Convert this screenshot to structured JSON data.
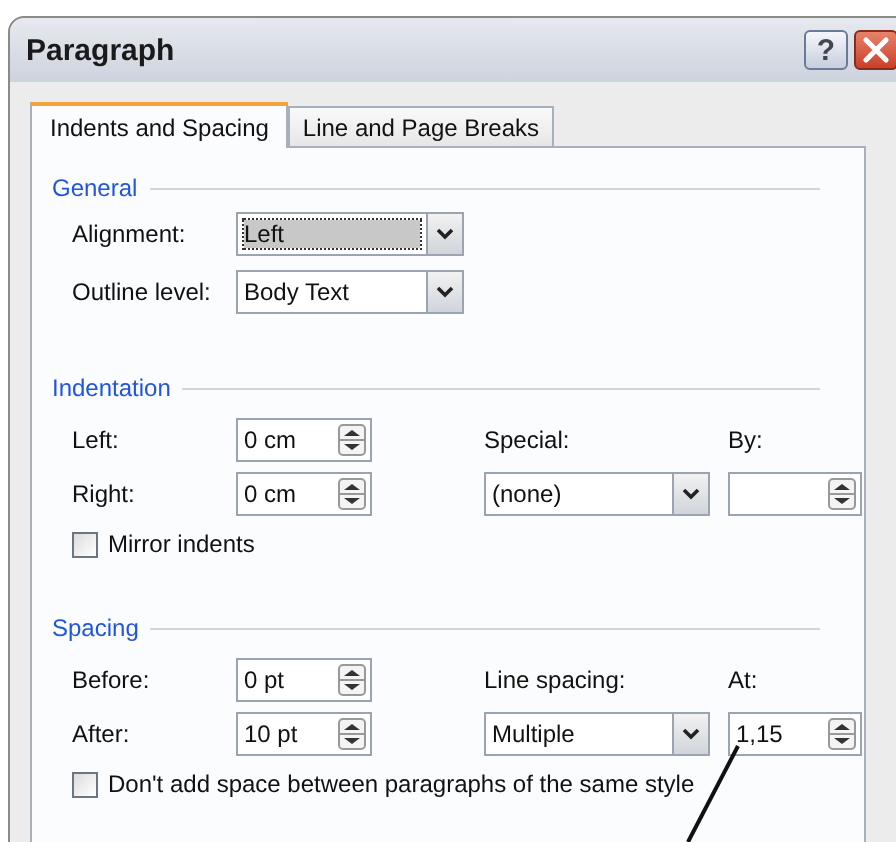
{
  "window": {
    "title": "Paragraph",
    "help_button": "?"
  },
  "tabs": [
    {
      "label": "Indents and Spacing",
      "selected": true
    },
    {
      "label": "Line and Page Breaks",
      "selected": false
    }
  ],
  "general": {
    "heading": "General",
    "alignment": {
      "label": "Alignment:",
      "value": "Left",
      "focused": true
    },
    "outline_level": {
      "label": "Outline level:",
      "value": "Body Text",
      "focused": false
    }
  },
  "indentation": {
    "heading": "Indentation",
    "left": {
      "label": "Left:",
      "value": "0 cm"
    },
    "right": {
      "label": "Right:",
      "value": "0 cm"
    },
    "special": {
      "label": "Special:",
      "value": "(none)"
    },
    "by": {
      "label": "By:"
    },
    "mirror_indents": {
      "label": "Mirror indents",
      "checked": false
    }
  },
  "spacing": {
    "heading": "Spacing",
    "before": {
      "label": "Before:",
      "value": "0 pt"
    },
    "after": {
      "label": "After:",
      "value": "10 pt"
    },
    "line_spacing": {
      "label": "Line spacing:",
      "value": "Multiple"
    },
    "at": {
      "label": "At:",
      "value": "1,15"
    },
    "dont_add_space": {
      "label": "Don't add space between paragraphs of the same style",
      "checked": false
    }
  }
}
